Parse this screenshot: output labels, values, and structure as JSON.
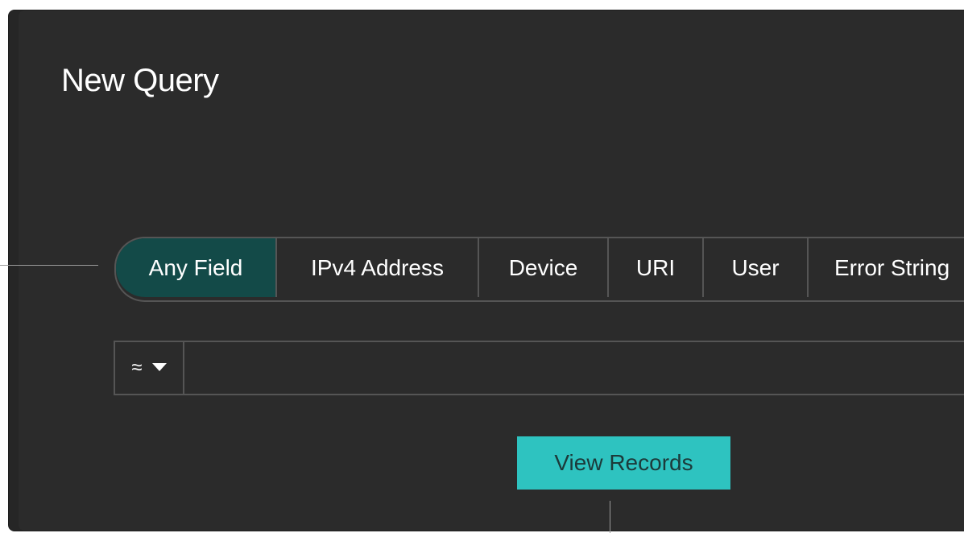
{
  "panel": {
    "title": "New Query"
  },
  "tabs": [
    {
      "label": "Any Field",
      "active": true
    },
    {
      "label": "IPv4 Address",
      "active": false
    },
    {
      "label": "Device",
      "active": false
    },
    {
      "label": "URI",
      "active": false
    },
    {
      "label": "User",
      "active": false
    },
    {
      "label": "Error String",
      "active": false
    }
  ],
  "operator": {
    "symbol": "≈",
    "icon": "chevron-down-icon"
  },
  "query_input": {
    "value": "",
    "placeholder": ""
  },
  "actions": {
    "view_records_label": "View Records"
  },
  "colors": {
    "panel_bg": "#2b2b2b",
    "active_tab": "#134a48",
    "primary_button": "#2ec3c0"
  }
}
